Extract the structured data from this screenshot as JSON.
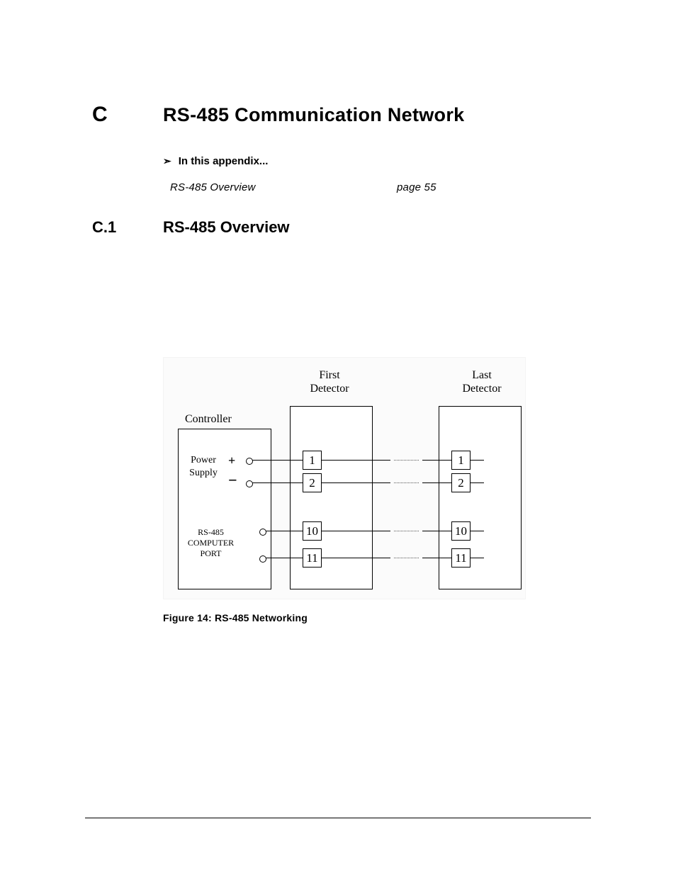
{
  "chapter": {
    "letter": "C",
    "title": "RS-485 Communication Network"
  },
  "appendix_intro": "In this appendix...",
  "toc": {
    "item": "RS-485 Overview",
    "page": "page 55"
  },
  "section": {
    "num": "C.1",
    "title": "RS-485 Overview"
  },
  "figure": {
    "caption": "Figure 14: RS-485 Networking",
    "labels": {
      "controller": "Controller",
      "first_line1": "First",
      "first_line2": "Detector",
      "last_line1": "Last",
      "last_line2": "Detector"
    },
    "controller": {
      "ps_line1": "Power",
      "ps_line2": "Supply",
      "plus": "+",
      "minus": "−",
      "port_line1": "RS-485",
      "port_line2": "COMPUTER",
      "port_line3": "PORT"
    },
    "terminals": {
      "t1": "1",
      "t2": "2",
      "t10": "10",
      "t11": "11"
    }
  }
}
